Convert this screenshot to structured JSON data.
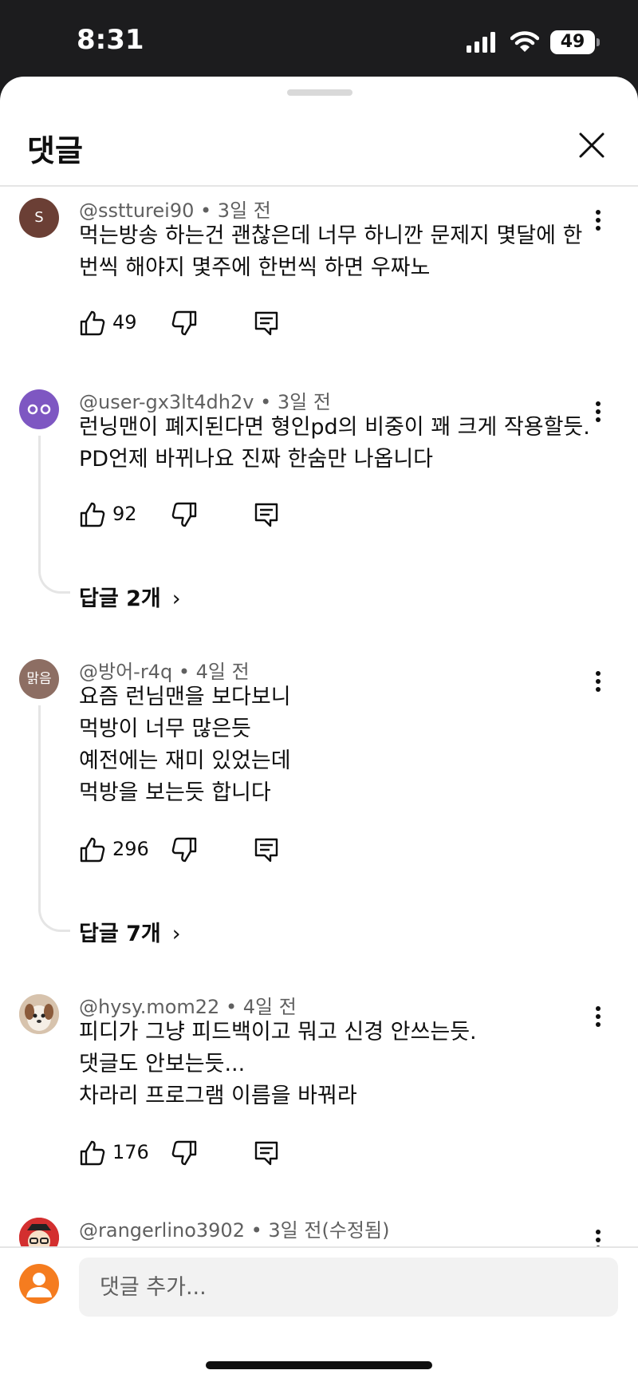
{
  "status_bar": {
    "time": "8:31",
    "battery": "49"
  },
  "sheet": {
    "title": "댓글"
  },
  "comments": [
    {
      "author": "@sstturei90",
      "age": "3일 전",
      "avatar_letter": "S",
      "avatar_color": "#6b3f35",
      "lines": [
        "먹는방송 하는건 괜찮은데 너무 하니깐 문제지 몇달에 한",
        "번씩 해야지 몇주에 한번씩 하면 우짜노"
      ],
      "likes": "49"
    },
    {
      "author": "@user-gx3lt4dh2v",
      "age": "3일 전",
      "avatar_color": "#7e57c2",
      "lines": [
        "런닝맨이 폐지된다면 형인pd의 비중이 꽤 크게 작용할듯.",
        "PD언제 바뀌나요 진짜 한숨만 나옵니다"
      ],
      "likes": "92",
      "replies": "답글 2개"
    },
    {
      "author": "@방어-r4q",
      "age": "4일 전",
      "avatar_text": "맑음",
      "avatar_color": "#8d6e63",
      "lines": [
        "요즘 런님맨을 보다보니",
        "먹방이 너무 많은듯",
        "예전에는 재미 있었는데",
        "먹방을 보는듯 합니다"
      ],
      "likes": "296",
      "replies": "답글 7개"
    },
    {
      "author": "@hysy.mom22",
      "age": "4일 전",
      "lines": [
        "피디가 그냥 피드백이고 뭐고 신경 안쓰는듯.",
        "댓글도 안보는듯...",
        "차라리 프로그램 이름을 바꿔라"
      ],
      "likes": "176"
    },
    {
      "author": "@rangerlino3902",
      "age": "3일 전(수정됨)"
    }
  ],
  "composer": {
    "placeholder": "댓글 추가..."
  },
  "icons": {
    "close": "close-icon",
    "more": "more-vert-icon",
    "like": "thumbs-up-icon",
    "dislike": "thumbs-down-icon",
    "reply": "reply-comment-icon",
    "chevron": "chevron-right-icon"
  }
}
